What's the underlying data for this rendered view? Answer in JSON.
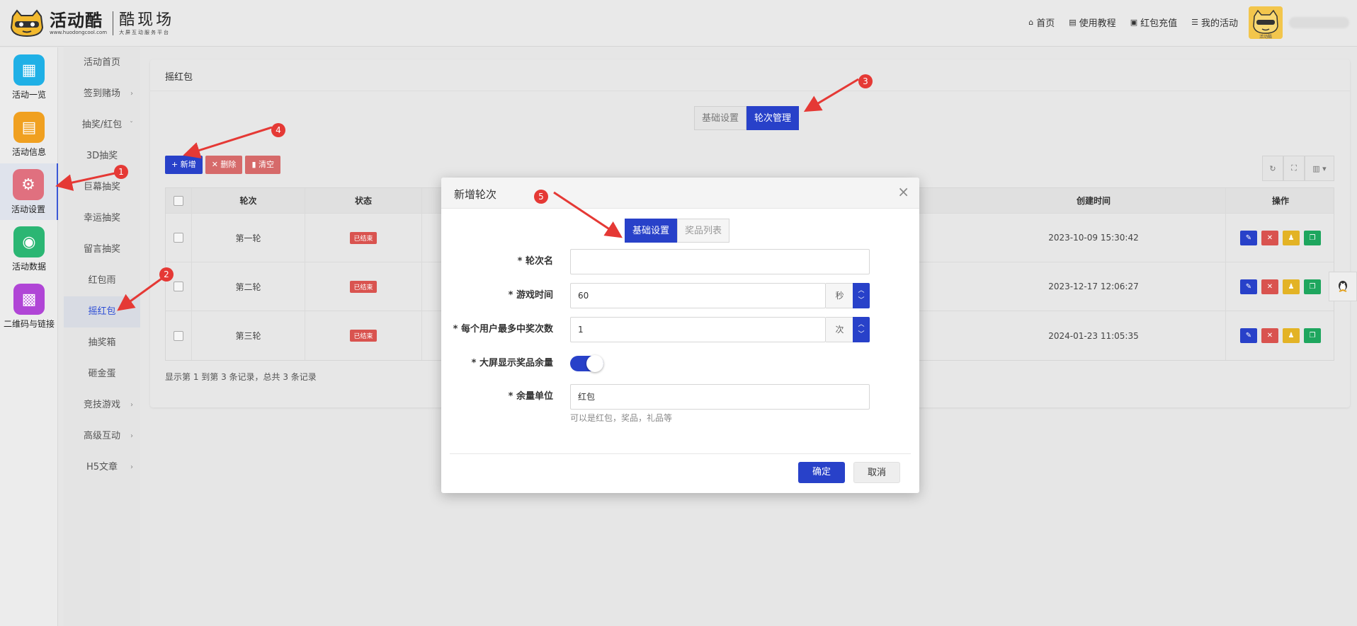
{
  "header": {
    "logo_text": "活动酷",
    "logo_url": "www.huodongcool.com",
    "logo_side": "酷现场",
    "logo_side_sub": "大屏互动服务平台",
    "nav": [
      {
        "icon": "home-icon",
        "glyph": "⌂",
        "label": "首页"
      },
      {
        "icon": "book-icon",
        "glyph": "▤",
        "label": "使用教程"
      },
      {
        "icon": "wallet-icon",
        "glyph": "▣",
        "label": "红包充值"
      },
      {
        "icon": "list-icon",
        "glyph": "☰",
        "label": "我的活动"
      }
    ],
    "avatar_caption": "活动酷"
  },
  "iconbar": [
    {
      "label": "活动一览",
      "icon": "grid-icon",
      "glyph": "▦",
      "color": "#1fb0e6"
    },
    {
      "label": "活动信息",
      "icon": "document-icon",
      "glyph": "▤",
      "color": "#f0a020"
    },
    {
      "label": "活动设置",
      "icon": "gear-icon",
      "glyph": "⚙",
      "color": "#e0707f"
    },
    {
      "label": "活动数据",
      "icon": "database-icon",
      "glyph": "◉",
      "color": "#2bb673"
    },
    {
      "label": "二维码与链接",
      "icon": "qrcode-icon",
      "glyph": "▩",
      "color": "#b045d6"
    }
  ],
  "submenu": [
    {
      "label": "活动首页",
      "arrow": ""
    },
    {
      "label": "签到赌场",
      "arrow": "›"
    },
    {
      "label": "抽奖/红包",
      "arrow": "ˇ"
    },
    {
      "label": "3D抽奖",
      "arrow": ""
    },
    {
      "label": "巨幕抽奖",
      "arrow": ""
    },
    {
      "label": "幸运抽奖",
      "arrow": ""
    },
    {
      "label": "留言抽奖",
      "arrow": ""
    },
    {
      "label": "红包雨",
      "arrow": ""
    },
    {
      "label": "摇红包",
      "arrow": ""
    },
    {
      "label": "抽奖箱",
      "arrow": ""
    },
    {
      "label": "砸金蛋",
      "arrow": ""
    },
    {
      "label": "竞技游戏",
      "arrow": "›"
    },
    {
      "label": "高级互动",
      "arrow": "›"
    },
    {
      "label": "H5文章",
      "arrow": "›"
    }
  ],
  "main": {
    "title": "摇红包",
    "tabs": [
      "基础设置",
      "轮次管理"
    ],
    "toolbar": {
      "add": "+ 新增",
      "delete": "✕ 删除",
      "clear": "▮ 清空"
    },
    "tools": {
      "refresh": "↻",
      "fullscreen": "⛶",
      "columns": "▥ ▾"
    },
    "table": {
      "headers": [
        "轮次",
        "状态",
        "创建时间",
        "操作"
      ],
      "rows": [
        {
          "round": "第一轮",
          "status": "已结束",
          "created": "2023-10-09 15:30:42"
        },
        {
          "round": "第二轮",
          "status": "已结束",
          "created": "2023-12-17 12:06:27"
        },
        {
          "round": "第三轮",
          "status": "已结束",
          "created": "2024-01-23 11:05:35"
        }
      ],
      "op_glyphs": {
        "edit": "✎",
        "delete": "✕",
        "user": "♟",
        "copy": "❐"
      }
    },
    "pagination_text": "显示第 1 到第 3 条记录，总共 3 条记录"
  },
  "modal": {
    "title": "新增轮次",
    "close": "×",
    "tabs": [
      "基础设置",
      "奖品列表"
    ],
    "fields": {
      "name_label": "* 轮次名",
      "name_value": "",
      "time_label": "* 游戏时间",
      "time_value": "60",
      "time_unit": "秒",
      "max_label": "* 每个用户最多中奖次数",
      "max_value": "1",
      "max_unit": "次",
      "show_label": "* 大屏显示奖品余量",
      "show_value": true,
      "unit_label": "* 余量单位",
      "unit_value": "红包",
      "unit_hint": "可以是红包，奖品，礼品等"
    },
    "ok": "确定",
    "cancel": "取消"
  },
  "annotations": [
    "1",
    "2",
    "3",
    "4",
    "5"
  ]
}
